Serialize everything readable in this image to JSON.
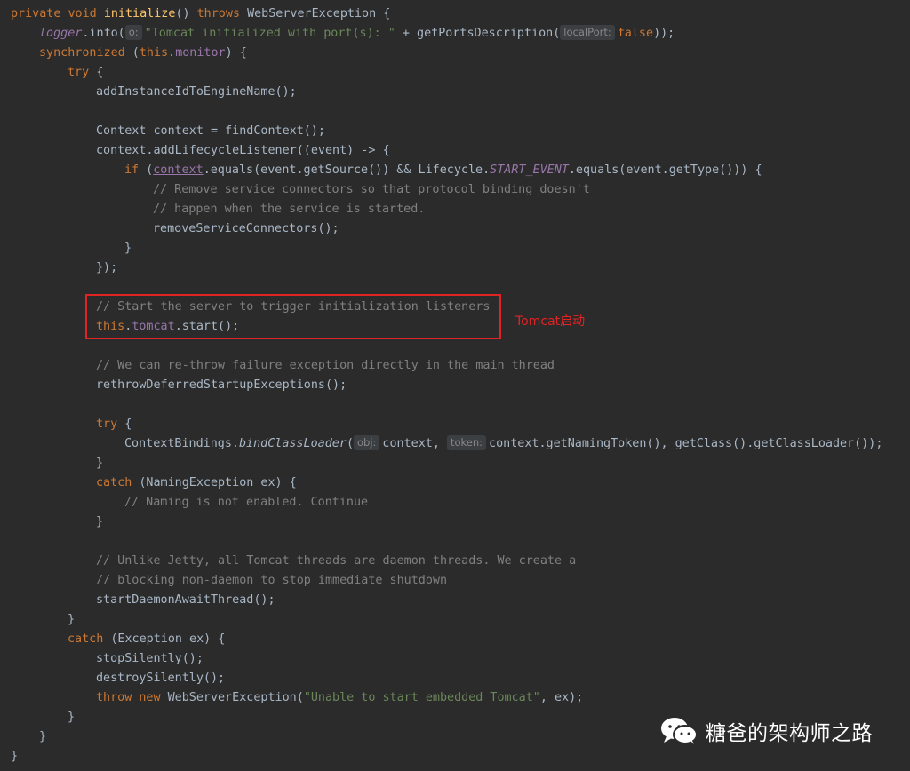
{
  "code": {
    "l1": [
      "private",
      "void",
      "initialize",
      "()",
      "throws",
      "WebServerException {"
    ],
    "l2": [
      "logger",
      ".info(",
      "o:",
      "\"Tomcat initialized with port(s): \"",
      " + getPortsDescription(",
      "localPort:",
      "false",
      "));"
    ],
    "l3": [
      "synchronized",
      " (",
      "this",
      ".",
      "monitor",
      ") {"
    ],
    "l4": [
      "try",
      " {"
    ],
    "l5": [
      "addInstanceIdToEngineName();"
    ],
    "l7": [
      "Context context = findContext();"
    ],
    "l8": [
      "context.addLifecycleListener((event) -> {"
    ],
    "l9": [
      "if",
      " (",
      "context",
      ".equals(event.getSource()) && Lifecycle.",
      "START_EVENT",
      ".equals(event.getType())) {"
    ],
    "l10": [
      "// Remove service connectors so that protocol binding doesn't"
    ],
    "l11": [
      "// happen when the service is started."
    ],
    "l12": [
      "removeServiceConnectors();"
    ],
    "l13": [
      "}"
    ],
    "l14": [
      "});"
    ],
    "l16": [
      "// Start the server to trigger initialization listeners"
    ],
    "l17": [
      "this",
      ".",
      "tomcat",
      ".start();"
    ],
    "l19": [
      "// We can re-throw failure exception directly in the main thread"
    ],
    "l20": [
      "rethrowDeferredStartupExceptions();"
    ],
    "l22": [
      "try",
      " {"
    ],
    "l23": [
      "ContextBindings.",
      "bindClassLoader",
      "(",
      "obj:",
      "context,",
      "token:",
      "context.getNamingToken(), getClass().getClassLoader());"
    ],
    "l24": [
      "}"
    ],
    "l25": [
      "catch",
      " (NamingException ex) {"
    ],
    "l26": [
      "// Naming is not enabled. Continue"
    ],
    "l27": [
      "}"
    ],
    "l29": [
      "// Unlike Jetty, all Tomcat threads are daemon threads. We create a"
    ],
    "l30": [
      "// blocking non-daemon to stop immediate shutdown"
    ],
    "l31": [
      "startDaemonAwaitThread();"
    ],
    "l32": [
      "}"
    ],
    "l33": [
      "catch",
      " (Exception ex) {"
    ],
    "l34": [
      "stopSilently();"
    ],
    "l35": [
      "destroySilently();"
    ],
    "l36": [
      "throw",
      "new",
      "WebServerException(",
      "\"Unable to start embedded Tomcat\"",
      ", ex);"
    ],
    "l37": [
      "}"
    ],
    "l38": [
      "}"
    ],
    "l39": [
      "}"
    ]
  },
  "annotation": {
    "label": "Tomcat启动",
    "color": "#e02323"
  },
  "watermark": {
    "icon": "wechat-icon",
    "text": "糖爸的架构师之路"
  },
  "colors": {
    "background": "#2b2b2b",
    "keyword": "#cc7832",
    "method": "#ffc66d",
    "field": "#9876aa",
    "string": "#6a8759",
    "comment": "#808080",
    "text": "#a9b7c6"
  }
}
